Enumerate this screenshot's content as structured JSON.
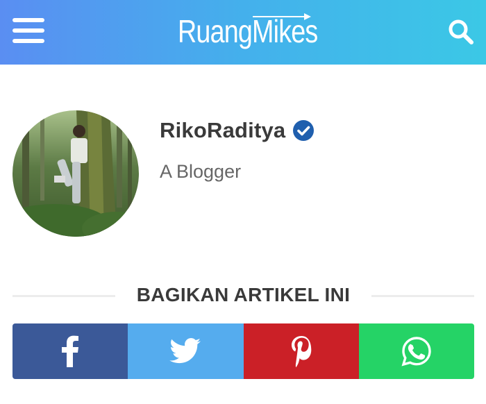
{
  "header": {
    "logo_text": "RuangMikes",
    "menu_icon": "hamburger-menu-icon",
    "search_icon": "search-icon",
    "gradient_start": "#5a8ef2",
    "gradient_end": "#3bc8e6"
  },
  "author": {
    "name": "RikoRaditya",
    "role": "A Blogger",
    "verified_icon": "verified-badge-icon",
    "verified_color": "#1f5fae"
  },
  "share": {
    "title": "BAGIKAN ARTIKEL INI",
    "buttons": [
      {
        "name": "facebook",
        "icon": "facebook-icon",
        "color": "#3b5998"
      },
      {
        "name": "twitter",
        "icon": "twitter-icon",
        "color": "#55acee"
      },
      {
        "name": "pinterest",
        "icon": "pinterest-icon",
        "color": "#cb2027"
      },
      {
        "name": "whatsapp",
        "icon": "whatsapp-icon",
        "color": "#25d366"
      }
    ]
  }
}
